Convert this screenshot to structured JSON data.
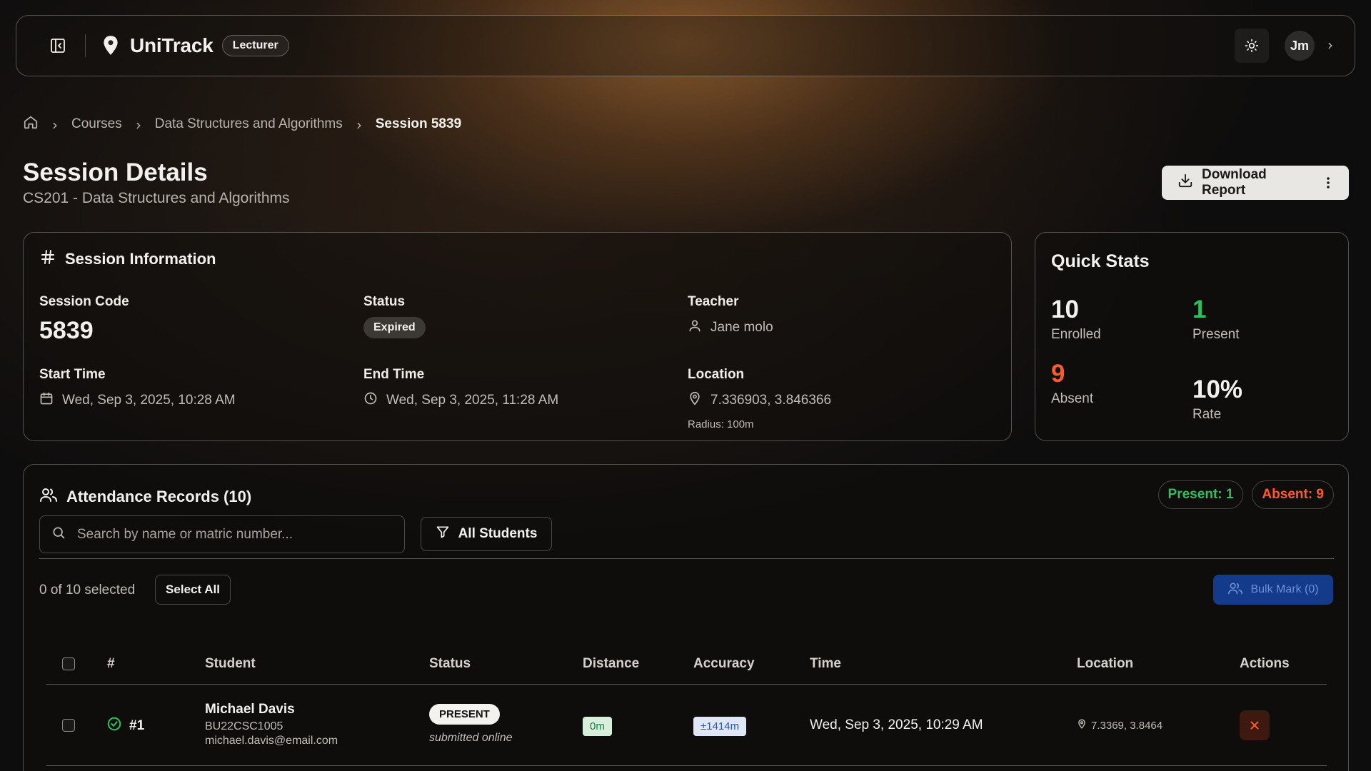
{
  "app": {
    "name": "UniTrack",
    "role_badge": "Lecturer",
    "user_initials": "Jm"
  },
  "breadcrumb": {
    "items": [
      "Courses",
      "Data Structures and Algorithms"
    ],
    "current": "Session 5839"
  },
  "page": {
    "title": "Session Details",
    "subtitle": "CS201 - Data Structures and Algorithms",
    "download_label": "Download Report"
  },
  "session_info": {
    "title": "Session Information",
    "code_label": "Session Code",
    "code": "5839",
    "status_label": "Status",
    "status": "Expired",
    "teacher_label": "Teacher",
    "teacher": "Jane molo",
    "start_label": "Start Time",
    "start": "Wed, Sep 3, 2025, 10:28 AM",
    "end_label": "End Time",
    "end": "Wed, Sep 3, 2025, 11:28 AM",
    "location_label": "Location",
    "location": "7.336903, 3.846366",
    "radius": "Radius: 100m"
  },
  "quick_stats": {
    "title": "Quick Stats",
    "enrolled_value": "10",
    "enrolled_label": "Enrolled",
    "present_value": "1",
    "present_label": "Present",
    "absent_value": "9",
    "absent_label": "Absent",
    "rate_value": "10%",
    "rate_label": "Rate"
  },
  "attendance": {
    "title": "Attendance Records (10)",
    "present_chip": "Present: 1",
    "absent_chip": "Absent: 9",
    "search_placeholder": "Search by name or matric number...",
    "filter_label": "All Students",
    "selected_text": "0 of 10 selected",
    "select_all_label": "Select All",
    "bulk_label": "Bulk Mark (0)",
    "columns": [
      "#",
      "Student",
      "Status",
      "Distance",
      "Accuracy",
      "Time",
      "Location",
      "Actions"
    ],
    "rows": [
      {
        "index": "#1",
        "name": "Michael Davis",
        "matric": "BU22CSC1005",
        "email": "michael.davis@email.com",
        "status": "PRESENT",
        "status_note": "submitted online",
        "distance": "0m",
        "accuracy": "±1414m",
        "time": "Wed, Sep 3, 2025, 10:29 AM",
        "location": "7.3369, 3.8464"
      }
    ]
  },
  "colors": {
    "present": "#2fbf5e",
    "absent": "#ff5a2e",
    "bulk_button": "#143a8a"
  }
}
